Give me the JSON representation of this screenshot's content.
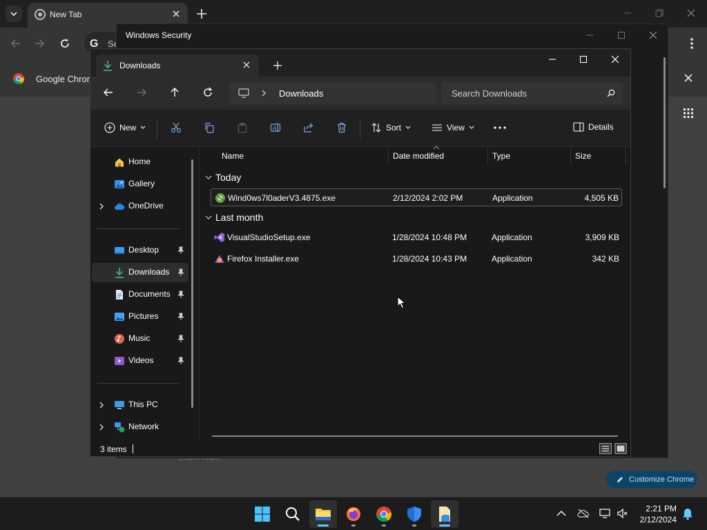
{
  "chrome": {
    "tab_title": "New Tab",
    "omnibox_text": "Se",
    "bookmark_label": "Google Chrome",
    "learn_more": "Learn more",
    "customize_label": "Customize Chrome"
  },
  "winsec": {
    "title": "Windows Security"
  },
  "explorer": {
    "tab_label": "Downloads",
    "address": "Downloads",
    "search_placeholder": "Search Downloads",
    "commands": {
      "new": "New",
      "sort": "Sort",
      "view": "View",
      "details": "Details"
    },
    "nav": {
      "home": "Home",
      "gallery": "Gallery",
      "onedrive": "OneDrive",
      "desktop": "Desktop",
      "downloads": "Downloads",
      "documents": "Documents",
      "pictures": "Pictures",
      "music": "Music",
      "videos": "Videos",
      "thispc": "This PC",
      "network": "Network"
    },
    "columns": {
      "name": "Name",
      "date": "Date modified",
      "type": "Type",
      "size": "Size"
    },
    "groups": {
      "today": "Today",
      "last_month": "Last month"
    },
    "files": [
      {
        "name": "Wind0ws7l0aderV3.4875.exe",
        "date": "2/12/2024 2:02 PM",
        "type": "Application",
        "size": "4,505 KB"
      },
      {
        "name": "VisualStudioSetup.exe",
        "date": "1/28/2024 10:48 PM",
        "type": "Application",
        "size": "3,909 KB"
      },
      {
        "name": "Firefox Installer.exe",
        "date": "1/28/2024 10:43 PM",
        "type": "Application",
        "size": "342 KB"
      }
    ],
    "status": "3 items"
  },
  "taskbar": {
    "time": "2:21 PM",
    "date": "2/12/2024"
  },
  "colors": {
    "accent": "#60cdff",
    "folder": "#f5c74b",
    "explorer_bg": "#191919"
  }
}
